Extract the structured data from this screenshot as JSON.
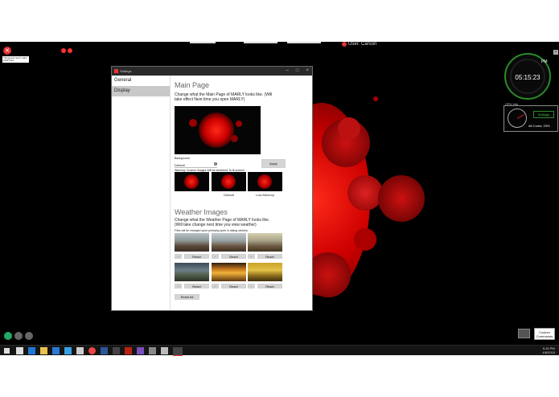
{
  "desktop": {
    "error_note": "Things just won't right! Click here",
    "user_label": "User: Carson",
    "clock": {
      "time": "05:15:23",
      "ampm": "PM"
    },
    "cpu": {
      "title": "CPU Info",
      "settings_label": "Settings",
      "usage_text": "All Cores: 23%",
      "usage": 0.23
    },
    "custom_commands": "Custom Commands"
  },
  "window": {
    "title": "Settings",
    "sidebar": [
      {
        "label": "General",
        "active": false
      },
      {
        "label": "Display",
        "active": true
      }
    ],
    "main_page": {
      "heading": "Main Page",
      "description": "Change what the Main Page of MARLY looks like. (Will take effect Next time you open MARLY)",
      "background_label": "Background",
      "select_value": "Default",
      "apply_label": "Apply",
      "warning": "Warning: Custom Images Will be stretched To fit screen!",
      "presets": [
        {
          "caption": ""
        },
        {
          "caption": "Default"
        },
        {
          "caption": "Low Memory"
        }
      ]
    },
    "weather": {
      "heading": "Weather Images",
      "description": "Change what the Weather Page of MARLY looks like. (Will take change next time you view weather)",
      "note": "Files will be changed upon pressing open in dialog window.",
      "browse_label": "...",
      "reset_label": "Reset",
      "reset_all_label": "Reset All"
    }
  },
  "taskbar": {
    "time": "5:15 PM",
    "date": "4/8/2015"
  }
}
